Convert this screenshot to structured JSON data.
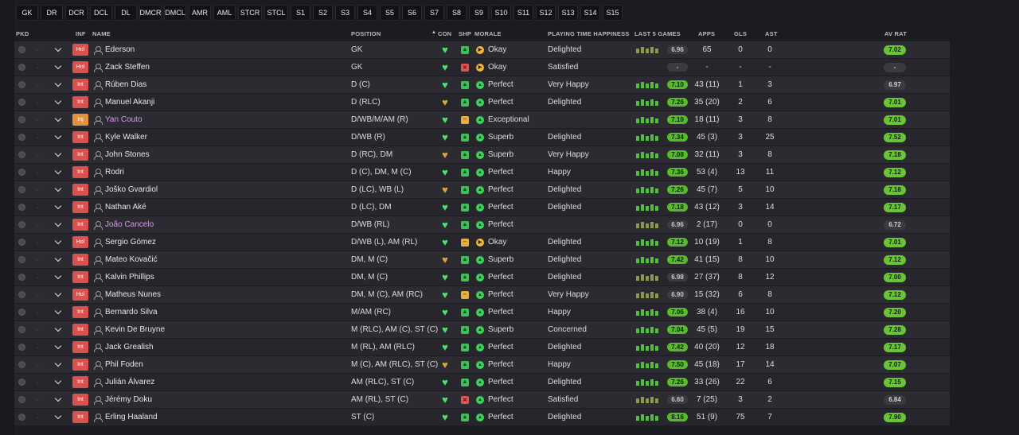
{
  "filters": [
    "GK",
    "DR",
    "DCR",
    "DCL",
    "DL",
    "DMCR",
    "DMCL",
    "AMR",
    "AML",
    "STCR",
    "STCL",
    "S1",
    "S2",
    "S3",
    "S4",
    "S5",
    "S6",
    "S7",
    "S8",
    "S9",
    "S10",
    "S11",
    "S12",
    "S13",
    "S14",
    "S15"
  ],
  "headers": {
    "pkd": "PKD",
    "inf": "INF",
    "name": "NAME",
    "position": "POSITION",
    "sort_arrow": "▲",
    "con": "CON",
    "shp": "SHP",
    "morale": "MORALE",
    "happiness": "PLAYING TIME HAPPINESS",
    "last5": "LAST 5 GAMES",
    "apps": "APPS",
    "gls": "GLS",
    "ast": "AST",
    "avrat": "AV RAT"
  },
  "colors": {
    "rating_green": "#59b831",
    "heart_green": "#4fe06a",
    "loan_name": "#d59be8",
    "badge_red": "#d8524f",
    "badge_orange": "#e3913a"
  },
  "players": [
    {
      "inf": "Hol",
      "name": "Ederson",
      "position": "GK",
      "con": "ok",
      "shp": "up",
      "morale": "Okay",
      "morale_tone": "yellow",
      "happy": "Delighted",
      "last5": "6.96",
      "last5_grey": true,
      "apps": "65",
      "gls": "0",
      "ast": "0",
      "av": "7.02",
      "av_grey": false
    },
    {
      "inf": "Hol",
      "name": "Zack Steffen",
      "position": "GK",
      "con": "ok",
      "shp": "red",
      "morale": "Okay",
      "morale_tone": "yellow",
      "happy": "Satisfied",
      "last5": "-",
      "last5_grey": true,
      "apps": "-",
      "gls": "-",
      "ast": "-",
      "av": "-",
      "av_grey": true
    },
    {
      "inf": "Int",
      "name": "Rúben Dias",
      "position": "D (C)",
      "con": "ok",
      "shp": "up",
      "morale": "Perfect",
      "morale_tone": "green",
      "happy": "Very Happy",
      "last5": "7.10",
      "last5_grey": false,
      "apps": "43 (11)",
      "gls": "1",
      "ast": "3",
      "av": "6.97",
      "av_grey": true
    },
    {
      "inf": "Int",
      "name": "Manuel Akanji",
      "position": "D (RLC)",
      "con": "warn",
      "shp": "up",
      "morale": "Perfect",
      "morale_tone": "green",
      "happy": "Delighted",
      "last5": "7.26",
      "last5_grey": false,
      "apps": "35 (20)",
      "gls": "2",
      "ast": "6",
      "av": "7.01",
      "av_grey": false
    },
    {
      "inf": "Inj",
      "name": "Yan Couto",
      "position": "D/WB/M/AM (R)",
      "con": "ok",
      "shp": "yel",
      "morale": "Exceptional",
      "morale_tone": "green",
      "happy": "",
      "last5": "7.10",
      "last5_grey": false,
      "apps": "18 (11)",
      "gls": "3",
      "ast": "8",
      "av": "7.01",
      "av_grey": false,
      "loan": true
    },
    {
      "inf": "Int",
      "name": "Kyle Walker",
      "position": "D/WB (R)",
      "con": "ok",
      "shp": "up",
      "morale": "Superb",
      "morale_tone": "green",
      "happy": "Delighted",
      "last5": "7.34",
      "last5_grey": false,
      "apps": "45 (3)",
      "gls": "3",
      "ast": "25",
      "av": "7.52",
      "av_grey": false
    },
    {
      "inf": "Int",
      "name": "John Stones",
      "position": "D (RC), DM",
      "con": "warn",
      "shp": "up",
      "morale": "Superb",
      "morale_tone": "green",
      "happy": "Very Happy",
      "last5": "7.08",
      "last5_grey": false,
      "apps": "32 (11)",
      "gls": "3",
      "ast": "8",
      "av": "7.18",
      "av_grey": false
    },
    {
      "inf": "Int",
      "name": "Rodri",
      "position": "D (C), DM, M (C)",
      "con": "ok",
      "shp": "up",
      "morale": "Perfect",
      "morale_tone": "green",
      "happy": "Happy",
      "last5": "7.36",
      "last5_grey": false,
      "apps": "53 (4)",
      "gls": "13",
      "ast": "11",
      "av": "7.12",
      "av_grey": false
    },
    {
      "inf": "Int",
      "name": "Joško Gvardiol",
      "position": "D (LC), WB (L)",
      "con": "warn",
      "shp": "up",
      "morale": "Perfect",
      "morale_tone": "green",
      "happy": "Delighted",
      "last5": "7.26",
      "last5_grey": false,
      "apps": "45 (7)",
      "gls": "5",
      "ast": "10",
      "av": "7.18",
      "av_grey": false
    },
    {
      "inf": "Int",
      "name": "Nathan Aké",
      "position": "D (LC), DM",
      "con": "ok",
      "shp": "up",
      "morale": "Perfect",
      "morale_tone": "green",
      "happy": "Delighted",
      "last5": "7.18",
      "last5_grey": false,
      "apps": "43 (12)",
      "gls": "3",
      "ast": "14",
      "av": "7.17",
      "av_grey": false
    },
    {
      "inf": "Int",
      "name": "João Cancelo",
      "position": "D/WB (RL)",
      "con": "ok",
      "shp": "up",
      "morale": "Perfect",
      "morale_tone": "green",
      "happy": "",
      "last5": "6.96",
      "last5_grey": true,
      "apps": "2 (17)",
      "gls": "0",
      "ast": "0",
      "av": "6.72",
      "av_grey": true,
      "loan": true
    },
    {
      "inf": "Hol",
      "name": "Sergio Gómez",
      "position": "D/WB (L), AM (RL)",
      "con": "ok",
      "shp": "yel",
      "morale": "Okay",
      "morale_tone": "yellow",
      "happy": "Delighted",
      "last5": "7.12",
      "last5_grey": false,
      "apps": "10 (19)",
      "gls": "1",
      "ast": "8",
      "av": "7.01",
      "av_grey": false
    },
    {
      "inf": "Int",
      "name": "Mateo Kovačić",
      "position": "DM, M (C)",
      "con": "warn",
      "shp": "up",
      "morale": "Superb",
      "morale_tone": "green",
      "happy": "Delighted",
      "last5": "7.42",
      "last5_grey": false,
      "apps": "41 (15)",
      "gls": "8",
      "ast": "10",
      "av": "7.12",
      "av_grey": false
    },
    {
      "inf": "Int",
      "name": "Kalvin Phillips",
      "position": "DM, M (C)",
      "con": "ok",
      "shp": "up",
      "morale": "Perfect",
      "morale_tone": "green",
      "happy": "Delighted",
      "last5": "6.98",
      "last5_grey": true,
      "apps": "27 (37)",
      "gls": "8",
      "ast": "12",
      "av": "7.00",
      "av_grey": false
    },
    {
      "inf": "Hol",
      "name": "Matheus Nunes",
      "position": "DM, M (C), AM (RC)",
      "con": "ok",
      "shp": "yel",
      "morale": "Perfect",
      "morale_tone": "green",
      "happy": "Very Happy",
      "last5": "6.90",
      "last5_grey": true,
      "apps": "15 (32)",
      "gls": "6",
      "ast": "8",
      "av": "7.12",
      "av_grey": false
    },
    {
      "inf": "Int",
      "name": "Bernardo Silva",
      "position": "M/AM (RC)",
      "con": "ok",
      "shp": "up",
      "morale": "Perfect",
      "morale_tone": "green",
      "happy": "Happy",
      "last5": "7.06",
      "last5_grey": false,
      "apps": "38 (4)",
      "gls": "16",
      "ast": "10",
      "av": "7.20",
      "av_grey": false
    },
    {
      "inf": "Int",
      "name": "Kevin De Bruyne",
      "position": "M (RLC), AM (C), ST (C)",
      "con": "ok",
      "shp": "up",
      "morale": "Superb",
      "morale_tone": "green",
      "happy": "Concerned",
      "last5": "7.04",
      "last5_grey": false,
      "apps": "45 (5)",
      "gls": "19",
      "ast": "15",
      "av": "7.28",
      "av_grey": false
    },
    {
      "inf": "Int",
      "name": "Jack Grealish",
      "position": "M (RL), AM (RLC)",
      "con": "ok",
      "shp": "up",
      "morale": "Perfect",
      "morale_tone": "green",
      "happy": "Delighted",
      "last5": "7.42",
      "last5_grey": false,
      "apps": "40 (20)",
      "gls": "12",
      "ast": "18",
      "av": "7.17",
      "av_grey": false
    },
    {
      "inf": "Int",
      "name": "Phil Foden",
      "position": "M (C), AM (RLC), ST (C)",
      "con": "warn",
      "shp": "up",
      "morale": "Perfect",
      "morale_tone": "green",
      "happy": "Happy",
      "last5": "7.50",
      "last5_grey": false,
      "apps": "45 (18)",
      "gls": "17",
      "ast": "14",
      "av": "7.07",
      "av_grey": false
    },
    {
      "inf": "Int",
      "name": "Julián Álvarez",
      "position": "AM (RLC), ST (C)",
      "con": "ok",
      "shp": "up",
      "morale": "Perfect",
      "morale_tone": "green",
      "happy": "Delighted",
      "last5": "7.26",
      "last5_grey": false,
      "apps": "33 (26)",
      "gls": "22",
      "ast": "6",
      "av": "7.15",
      "av_grey": false
    },
    {
      "inf": "Int",
      "name": "Jérémy Doku",
      "position": "AM (RL), ST (C)",
      "con": "ok",
      "shp": "red",
      "morale": "Perfect",
      "morale_tone": "green",
      "happy": "Satisfied",
      "last5": "6.60",
      "last5_grey": true,
      "apps": "7 (25)",
      "gls": "3",
      "ast": "2",
      "av": "6.84",
      "av_grey": true
    },
    {
      "inf": "Int",
      "name": "Erling Haaland",
      "position": "ST (C)",
      "con": "ok",
      "shp": "up",
      "morale": "Perfect",
      "morale_tone": "green",
      "happy": "Delighted",
      "last5": "8.16",
      "last5_grey": false,
      "apps": "51 (9)",
      "gls": "75",
      "ast": "7",
      "av": "7.90",
      "av_grey": false
    }
  ]
}
